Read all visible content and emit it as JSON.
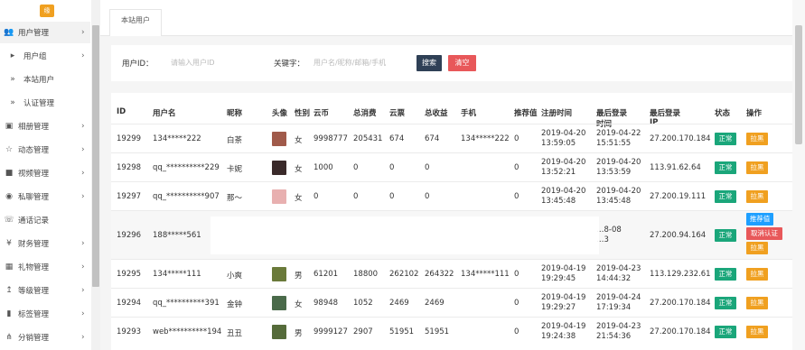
{
  "sidebar": {
    "logo_text": "缘",
    "items": [
      {
        "icon": "users-icon",
        "glyph": "👥",
        "label": "用户管理",
        "chev": "›"
      },
      {
        "icon": "bullet-icon",
        "glyph": "▸",
        "label": "用户组",
        "chev": "›"
      },
      {
        "icon": "bullet-icon",
        "glyph": "»",
        "label": "本站用户",
        "chev": ""
      },
      {
        "icon": "bullet-icon",
        "glyph": "»",
        "label": "认证管理",
        "chev": ""
      },
      {
        "icon": "image-icon",
        "glyph": "▣",
        "label": "相册管理",
        "chev": "›"
      },
      {
        "icon": "star-icon",
        "glyph": "☆",
        "label": "动态管理",
        "chev": "›"
      },
      {
        "icon": "video-icon",
        "glyph": "■",
        "label": "视频管理",
        "chev": "›"
      },
      {
        "icon": "message-icon",
        "glyph": "◉",
        "label": "私聊管理",
        "chev": "›"
      },
      {
        "icon": "call-icon",
        "glyph": "☏",
        "label": "通话记录",
        "chev": ""
      },
      {
        "icon": "yen-icon",
        "glyph": "¥",
        "label": "财务管理",
        "chev": "›"
      },
      {
        "icon": "gift-icon",
        "glyph": "▦",
        "label": "礼物管理",
        "chev": "›"
      },
      {
        "icon": "level-icon",
        "glyph": "↥",
        "label": "等级管理",
        "chev": "›"
      },
      {
        "icon": "tag-icon",
        "glyph": "▮",
        "label": "标签管理",
        "chev": "›"
      },
      {
        "icon": "share-icon",
        "glyph": "⋔",
        "label": "分销管理",
        "chev": "›"
      }
    ]
  },
  "tab": {
    "label": "本站用户"
  },
  "filter": {
    "user_id_label": "用户ID：",
    "user_id_placeholder": "请输入用户ID",
    "keyword_label": "关键字：",
    "keyword_placeholder": "用户名/昵称/邮箱/手机",
    "search_label": "搜索",
    "clear_label": "清空"
  },
  "table": {
    "headers": {
      "id": "ID",
      "username": "用户名",
      "nickname": "昵称",
      "avatar": "头像",
      "gender": "性别",
      "coins": "云币",
      "total_spent": "总消费",
      "tickets": "云票",
      "total_income": "总收益",
      "phone": "手机",
      "recommend": "推荐值",
      "reg_time": "注册时间",
      "last_login": "最后登录时间",
      "last_ip": "最后登录IP",
      "status": "状态",
      "actions": "操作"
    },
    "status_label": "正常",
    "action_label": "拉黑",
    "recommend_label": "推荐值",
    "cancel_auth_label": "取消认证",
    "rows": [
      {
        "id": "19299",
        "username": "134*****222",
        "nickname": "白茶",
        "gender": "女",
        "coins": "9998777",
        "total_spent": "205431",
        "tickets": "674",
        "total_income": "674",
        "phone": "134*****222",
        "recommend": "0",
        "reg_date": "2019-04-20",
        "reg_time": "13:59:05",
        "login_date": "2019-04-22",
        "login_time": "15:51:55",
        "ip": "27.200.170.184",
        "avatar_color": "#a05a4a"
      },
      {
        "id": "19298",
        "username": "qq_**********229",
        "nickname": "卡妮",
        "gender": "女",
        "coins": "1000",
        "total_spent": "0",
        "tickets": "0",
        "total_income": "0",
        "phone": "",
        "recommend": "0",
        "reg_date": "2019-04-20",
        "reg_time": "13:52:21",
        "login_date": "2019-04-20",
        "login_time": "13:53:59",
        "ip": "113.91.62.64",
        "avatar_color": "#3a2a2a"
      },
      {
        "id": "19297",
        "username": "qq_**********907",
        "nickname": "那～",
        "gender": "女",
        "coins": "0",
        "total_spent": "0",
        "tickets": "0",
        "total_income": "0",
        "phone": "",
        "recommend": "0",
        "reg_date": "2019-04-20",
        "reg_time": "13:45:48",
        "login_date": "2019-04-20",
        "login_time": "13:45:48",
        "ip": "27.200.19.111",
        "avatar_color": "#e8b0b0"
      },
      {
        "id": "19296",
        "username": "188*****561",
        "nickname": "",
        "gender": "",
        "coins": "",
        "total_spent": "",
        "tickets": "",
        "total_income": "",
        "phone": "",
        "recommend": "",
        "reg_date": "",
        "reg_time": "",
        "login_date": "…8-08",
        "login_time": "…3",
        "ip": "27.200.94.164",
        "avatar_color": ""
      },
      {
        "id": "19295",
        "username": "134*****111",
        "nickname": "小爽",
        "gender": "男",
        "coins": "61201",
        "total_spent": "18800",
        "tickets": "262102",
        "total_income": "264322",
        "phone": "134*****111",
        "recommend": "0",
        "reg_date": "2019-04-19",
        "reg_time": "19:29:45",
        "login_date": "2019-04-23",
        "login_time": "14:44:32",
        "ip": "113.129.232.61",
        "avatar_color": "#6a7a3a"
      },
      {
        "id": "19294",
        "username": "qq_**********391",
        "nickname": "金钟",
        "gender": "女",
        "coins": "98948",
        "total_spent": "1052",
        "tickets": "2469",
        "total_income": "2469",
        "phone": "",
        "recommend": "0",
        "reg_date": "2019-04-19",
        "reg_time": "19:29:27",
        "login_date": "2019-04-24",
        "login_time": "17:19:34",
        "ip": "27.200.170.184",
        "avatar_color": "#4a6a4a"
      },
      {
        "id": "19293",
        "username": "web**********194",
        "nickname": "丑丑",
        "gender": "男",
        "coins": "9999127",
        "total_spent": "2907",
        "tickets": "51951",
        "total_income": "51951",
        "phone": "",
        "recommend": "0",
        "reg_date": "2019-04-19",
        "reg_time": "19:24:38",
        "login_date": "2019-04-23",
        "login_time": "21:54:36",
        "ip": "27.200.170.184",
        "avatar_color": "#556b3a"
      }
    ]
  }
}
